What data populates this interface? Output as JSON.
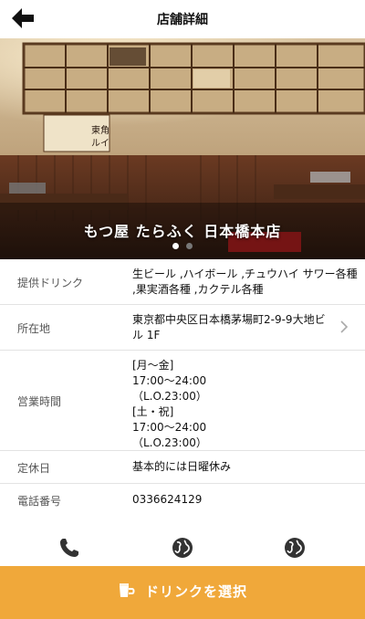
{
  "header": {
    "title": "店舗詳細",
    "back_icon": "back-arrow-icon"
  },
  "hero": {
    "store_name": "もつ屋 たらふく 日本橋本店",
    "sign_text": "東角\nルイ",
    "carousel": {
      "pages": 2,
      "active": 1
    }
  },
  "details": {
    "drink": {
      "label": "提供ドリンク",
      "lines": [
        "生ビール ,ハイボール ,チュウハイ サワー各種",
        ",果実酒各種 ,カクテル各種"
      ]
    },
    "address": {
      "label": "所在地",
      "lines": [
        "東京都中央区日本橋茅場町2-9-9大地ビ",
        "ル 1F"
      ],
      "icon": "chevron-right-icon"
    },
    "hours": {
      "label": "営業時間",
      "lines": [
        "[月～金]",
        "17:00～24:00",
        "（L.O.23:00）",
        "[土・祝]",
        "17:00～24:00",
        "（L.O.23:00）"
      ]
    },
    "closed": {
      "label": "定休日",
      "value": "基本的には日曜休み"
    },
    "phone": {
      "label": "電話番号",
      "value": "0336624129"
    }
  },
  "actions": [
    "phone-icon",
    "globe-icon",
    "globe-icon"
  ],
  "cta": {
    "label": "ドリンクを選択",
    "icon": "drink-icon"
  },
  "colors": {
    "accent": "#f0a83a",
    "divider": "#e3e3e3"
  }
}
